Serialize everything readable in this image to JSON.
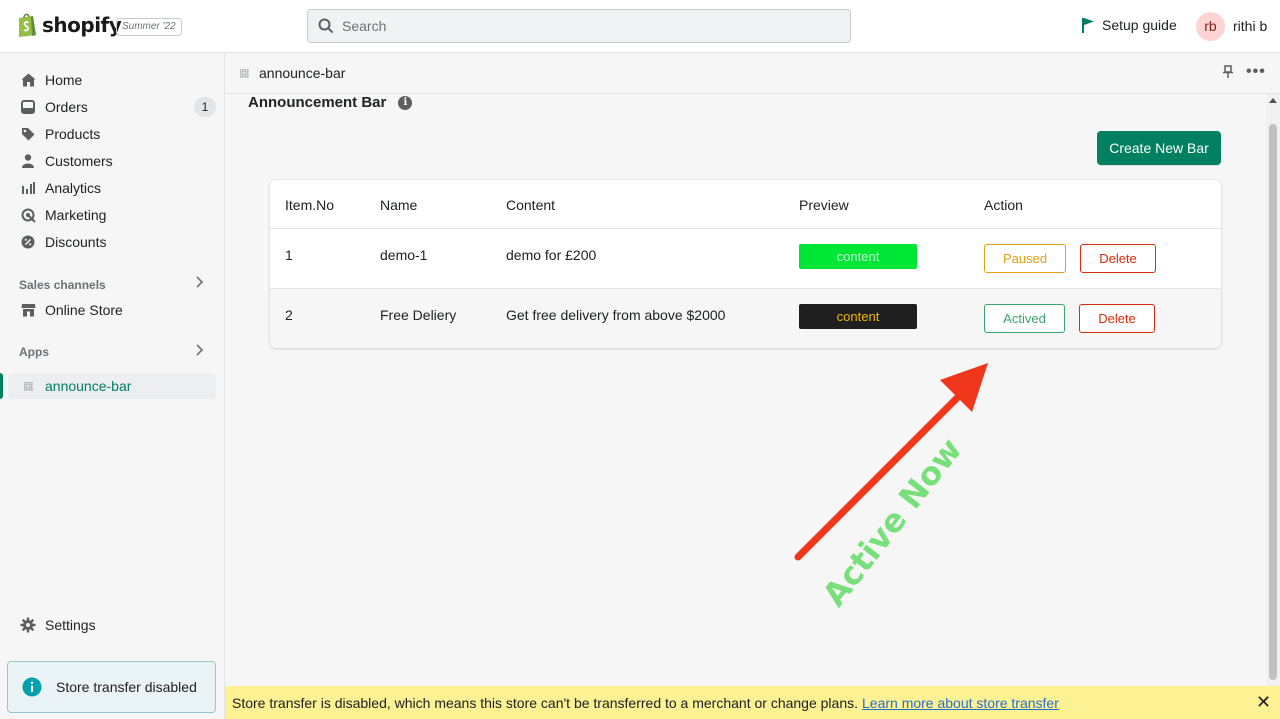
{
  "topbar": {
    "brand": "shopify",
    "edition": "Summer '22",
    "search_placeholder": "Search",
    "setup_guide": "Setup guide",
    "avatar_initials": "rb",
    "user_name": "rithi b"
  },
  "sidebar": {
    "items": [
      {
        "label": "Home",
        "icon": "home-icon"
      },
      {
        "label": "Orders",
        "icon": "orders-icon",
        "badge": "1"
      },
      {
        "label": "Products",
        "icon": "tag-icon"
      },
      {
        "label": "Customers",
        "icon": "person-icon"
      },
      {
        "label": "Analytics",
        "icon": "bar-chart-icon"
      },
      {
        "label": "Marketing",
        "icon": "target-icon"
      },
      {
        "label": "Discounts",
        "icon": "discount-icon"
      }
    ],
    "sales_channels_title": "Sales channels",
    "online_store": "Online Store",
    "apps_title": "Apps",
    "active_app": "announce-bar",
    "settings": "Settings",
    "transfer_notice": "Store transfer disabled"
  },
  "main": {
    "app_name": "announce-bar",
    "page_title": "Announcement Bar",
    "create_button": "Create New Bar",
    "columns": [
      "Item.No",
      "Name",
      "Content",
      "Preview",
      "Action"
    ],
    "rows": [
      {
        "no": "1",
        "name": "demo-1",
        "content": "demo for £200",
        "preview": "content",
        "status_button": "Paused",
        "delete_button": "Delete"
      },
      {
        "no": "2",
        "name": "Free Deliery",
        "content": "Get free delivery from above $2000",
        "preview": "content",
        "status_button": "Actived",
        "delete_button": "Delete"
      }
    ]
  },
  "banner": {
    "text": "Store transfer is disabled, which means this store can't be transferred to a merchant or change plans.",
    "link": "Learn more about store transfer"
  },
  "annotation": {
    "text": "Active Now"
  },
  "colors": {
    "brand_green": "#008060",
    "preview_green": "#00e636",
    "preview_dark": "#1f1f1f",
    "paused": "#e3a017",
    "actived": "#3aa56f",
    "delete": "#d82c0d",
    "arrow": "#f0371c",
    "annotation_text": "#77e07a"
  }
}
